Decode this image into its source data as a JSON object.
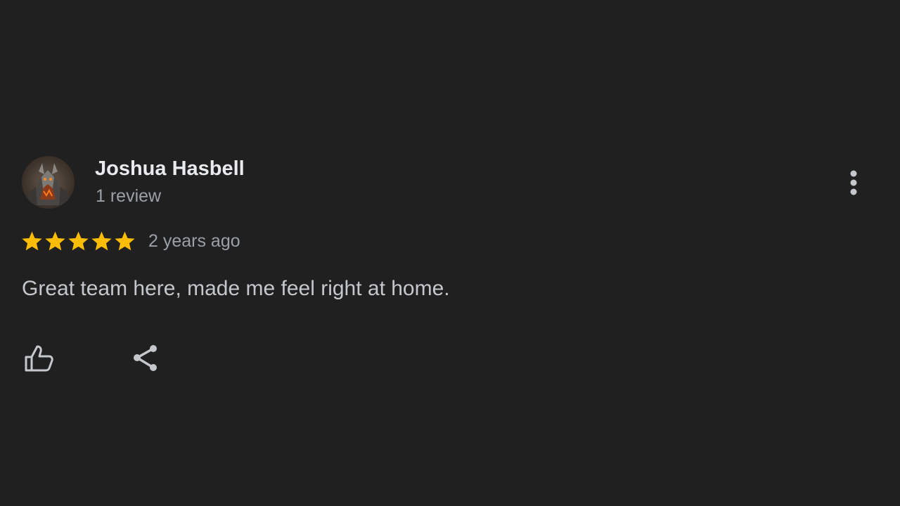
{
  "review": {
    "author": {
      "name": "Joshua Hasbell",
      "review_count": "1 review",
      "avatar_icon": "armored-warrior-avatar"
    },
    "rating": 5,
    "rating_max": 5,
    "timestamp": "2 years ago",
    "text": "Great team here, made me feel right at home.",
    "actions": {
      "like_icon": "thumbs-up-icon",
      "share_icon": "share-icon",
      "more_icon": "more-vert-icon"
    }
  },
  "colors": {
    "background": "#202020",
    "star": "#fbbc04",
    "name": "#e8eaed",
    "secondary_text": "#9aa0a6",
    "body_text": "#c4c7cb",
    "icon": "#c4c7cb"
  }
}
